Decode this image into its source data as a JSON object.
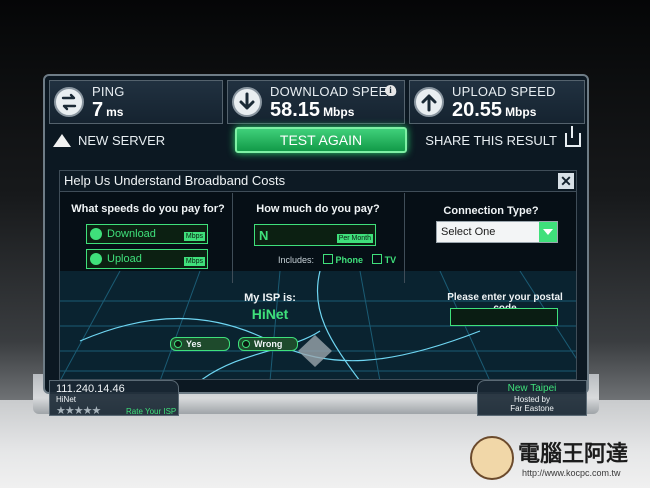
{
  "stats": {
    "ping": {
      "label": "PING",
      "value": "7",
      "unit": "ms"
    },
    "download": {
      "label": "DOWNLOAD SPEED",
      "value": "58.15",
      "unit": "Mbps"
    },
    "upload": {
      "label": "UPLOAD SPEED",
      "value": "20.55",
      "unit": "Mbps"
    }
  },
  "actions": {
    "new_server": "NEW SERVER",
    "test_again": "TEST AGAIN",
    "share": "SHARE THIS RESULT"
  },
  "panel": {
    "title": "Help Us Understand Broadband Costs",
    "close": "X",
    "q_speeds": "What speeds do you pay for?",
    "download_label": "Download",
    "upload_label": "Upload",
    "speed_unit": "Mbps",
    "q_cost": "How much do you pay?",
    "cost_value": "N",
    "cost_unit": "Per Month",
    "includes_label": "Includes:",
    "includes_phone": "Phone",
    "includes_tv": "TV",
    "q_connection": "Connection Type?",
    "connection_selected": "Select One",
    "isp_question": "My ISP is:",
    "isp_name": "HiNet",
    "yes": "Yes",
    "wrong": "Wrong",
    "postal_question": "Please enter your postal code"
  },
  "client": {
    "ip": "111.240.14.46",
    "isp": "HiNet",
    "stars": "★★★★★",
    "rate_label": "Rate Your ISP"
  },
  "server": {
    "city": "New Taipei",
    "hosted_by": "Hosted by",
    "host": "Far Eastone"
  },
  "watermark": {
    "text": "電腦王阿達",
    "url": "http://www.kocpc.com.tw"
  },
  "colors": {
    "accent_green": "#3fe07b",
    "panel_bg": "#0c1822"
  }
}
